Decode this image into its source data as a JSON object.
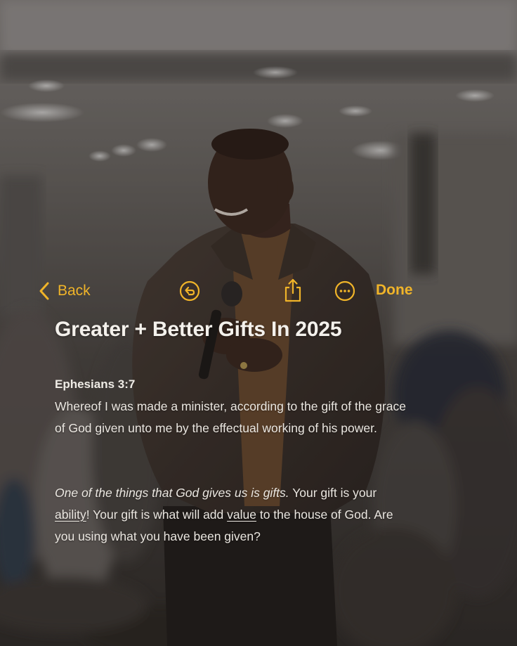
{
  "toolbar": {
    "back_label": "Back",
    "done_label": "Done",
    "accent_color": "#f0b429",
    "icons": [
      "chevron-left-icon",
      "undo-icon",
      "share-icon",
      "more-icon"
    ]
  },
  "note": {
    "title": "Greater + Better Gifts In 2025",
    "scripture_reference": "Ephesians 3:7",
    "scripture_text": "Whereof I was made a minister, according to the gift of the grace of God given unto me by the effectual working of his power.",
    "body": {
      "italic_lead": "One of the things that God gives us is gifts.",
      "text_a": " Your gift is your ",
      "underline_1": "ability",
      "text_b": "! Your gift is what will add ",
      "underline_2": "value",
      "text_c": " to the house of God. Are you using what you have been given?"
    }
  },
  "background": {
    "description_icon": "photo-background"
  }
}
